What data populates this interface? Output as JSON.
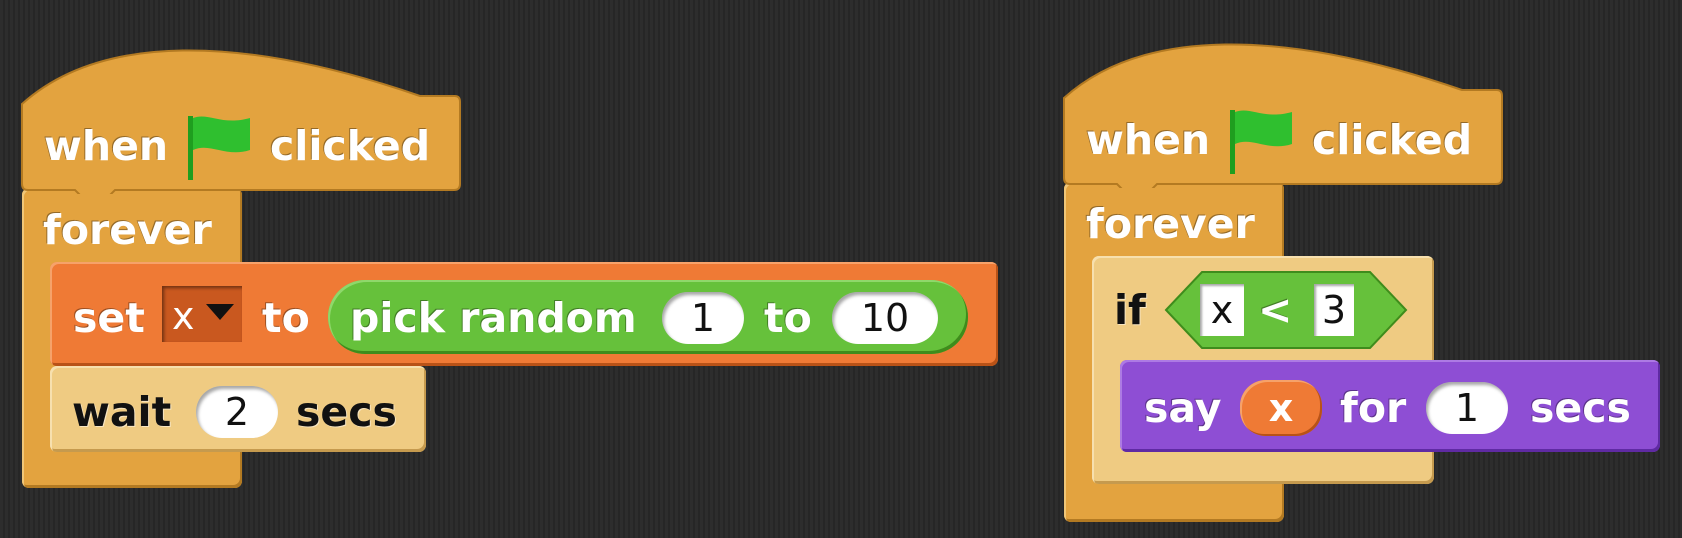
{
  "script_left": {
    "hat": {
      "when": "when",
      "clicked": "clicked",
      "icon": "green-flag-icon"
    },
    "forever": "forever",
    "set_block": {
      "set": "set",
      "var": "x",
      "to": "to",
      "reporter": {
        "pick_random": "pick random",
        "from": "1",
        "to": "to",
        "until": "10"
      }
    },
    "wait_block": {
      "wait": "wait",
      "secs_value": "2",
      "secs": "secs"
    }
  },
  "script_right": {
    "hat": {
      "when": "when",
      "clicked": "clicked",
      "icon": "green-flag-icon"
    },
    "forever": "forever",
    "if_block": {
      "if": "if",
      "condition": {
        "left": "x",
        "op": "<",
        "right": "3"
      }
    },
    "say_block": {
      "say": "say",
      "var": "x",
      "for": "for",
      "secs_value": "1",
      "secs": "secs"
    }
  },
  "colors": {
    "events": "#e3a33f",
    "control_light": "#efcb82",
    "variables": "#ef7a35",
    "operators": "#66c13b",
    "looks": "#8e4ed4",
    "flag": "#2fbf2f"
  }
}
